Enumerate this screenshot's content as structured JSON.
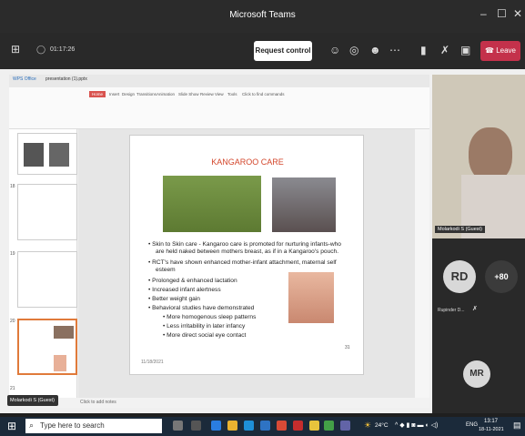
{
  "window": {
    "title": "Microsoft Teams"
  },
  "meeting": {
    "timer": "01:17:26",
    "request_control": "Request control",
    "leave": "Leave"
  },
  "app_tabs": [
    "WPS Office",
    "presentation (1).pptx"
  ],
  "ribbon_tabs": [
    "Home",
    "Insert",
    "Design",
    "Transitions",
    "Animation",
    "Slide Show",
    "Review",
    "View",
    "Tools",
    "Click to find commands"
  ],
  "slide": {
    "title": "KANGAROO CARE",
    "bullets": [
      "Skin to Skin care - Kangaroo care is promoted for nurturing infants-who",
      "are held naked between mothers breast, as if in a Kangaroo's pouch.",
      "RCT's have shown enhanced mother-infant attachment, maternal self",
      "esteem",
      "Prolonged & enhanced lactation",
      "Increased infant alertness",
      "Better weight gain",
      "Behavioral studies have demonstrated"
    ],
    "sub_bullets": [
      "More homogenous sleep patterns",
      "Less irritability in later infancy",
      "More direct social eye contact"
    ],
    "date": "11/18/2021",
    "page": "31"
  },
  "thumb_numbers": [
    "18",
    "19",
    "20",
    "21"
  ],
  "status": {
    "notes_placeholder": "Click to add notes"
  },
  "participants": {
    "video_name": "Molarkodi S (Guest)",
    "rd_initials": "RD",
    "rd_name": "Rupinder D...",
    "more": "+80",
    "mr_initials": "MR",
    "share_label": "Molarkodi S (Guest)"
  },
  "taskbar": {
    "search_placeholder": "Type here to search",
    "temperature": "24°C",
    "lang": "ENG",
    "time": "13:17",
    "date": "18-11-2021"
  },
  "colors": {
    "leave": "#c4314b",
    "teams_bg": "#292929",
    "title_red": "#d3462b",
    "taskbar": "#1b2a3a"
  }
}
